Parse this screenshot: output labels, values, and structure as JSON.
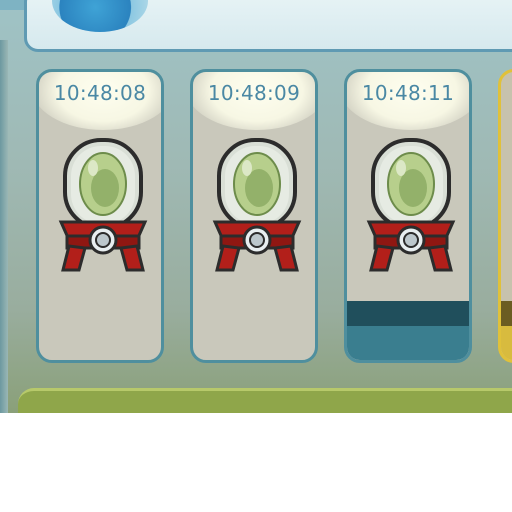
{
  "incubators": [
    {
      "timer": "10:48:08",
      "selected": false
    },
    {
      "timer": "10:48:09",
      "selected": false
    },
    {
      "timer": "10:48:11",
      "selected": true
    }
  ],
  "icons": {
    "top_badge": "badge-icon",
    "incubator": "egg-incubator-icon"
  },
  "colors": {
    "timer_text": "#4a88a4",
    "card_border": "#4f8f9e",
    "side_card_border": "#e0c13a",
    "bottom_bar": "#8fa64a"
  }
}
